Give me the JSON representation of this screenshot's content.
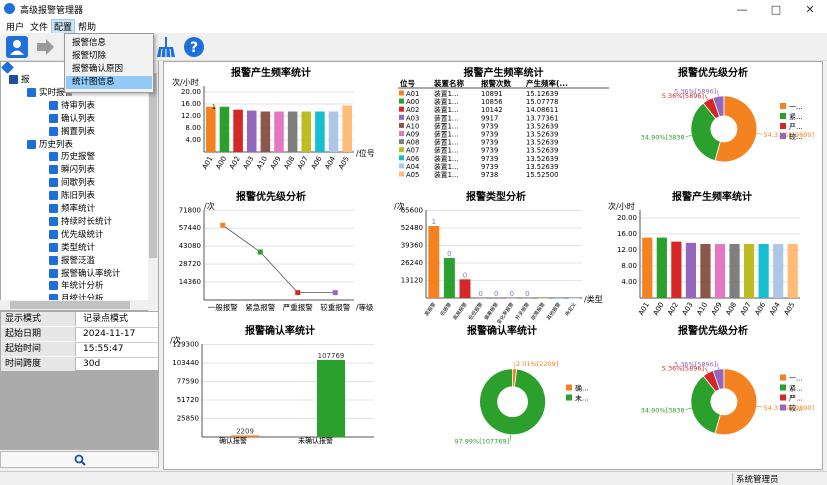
{
  "window": {
    "title": "高级报警管理器",
    "minimize_icon": "minimize-icon",
    "maximize_icon": "maximize-icon",
    "close_icon": "close-icon"
  },
  "menu": [
    {
      "label": "用户"
    },
    {
      "label": "文件"
    },
    {
      "label": "配置"
    },
    {
      "label": "帮助"
    }
  ],
  "dropdown": [
    {
      "label": "报警信息"
    },
    {
      "label": "报警切除"
    },
    {
      "label": "报警确认原因"
    },
    {
      "label": "统计图信息"
    }
  ],
  "toolbar": {
    "icons": [
      "user-icon",
      "export-icon",
      "clean-icon",
      "help-icon"
    ]
  },
  "tree": [
    {
      "label": "报",
      "level": 1
    },
    {
      "label": "实时报警",
      "level": 2
    },
    {
      "label": "待审列表",
      "level": 3
    },
    {
      "label": "确认列表",
      "level": 3
    },
    {
      "label": "搁置列表",
      "level": 3
    },
    {
      "label": "历史列表",
      "level": 2
    },
    {
      "label": "历史报警",
      "level": 3
    },
    {
      "label": "瞬闪列表",
      "level": 3
    },
    {
      "label": "间歇列表",
      "level": 3
    },
    {
      "label": "陈旧列表",
      "level": 3
    },
    {
      "label": "频率统计",
      "level": 3
    },
    {
      "label": "持续时长统计",
      "level": 3
    },
    {
      "label": "优先级统计",
      "level": 3
    },
    {
      "label": "类型统计",
      "level": 3
    },
    {
      "label": "报警泛滥",
      "level": 3
    },
    {
      "label": "报警确认率统计",
      "level": 3
    },
    {
      "label": "年统计分析",
      "level": 3
    },
    {
      "label": "月统计分析",
      "level": 3
    }
  ],
  "info": {
    "mode_key": "显示模式",
    "mode_val": "记录点模式",
    "date_key": "起始日期",
    "date_val": "2024-11-17",
    "time_key": "起始时间",
    "time_val": "15:55:47",
    "span_key": "时间跨度",
    "span_val": "30d"
  },
  "statusbar": {
    "user": "系统管理员"
  },
  "colors": {
    "orange": "#f58220",
    "green": "#2ca02c",
    "red": "#d62728",
    "purple": "#9467bd",
    "brown": "#8c564b",
    "pink": "#e377c2",
    "grey": "#7f7f7f",
    "olive": "#bcbd22",
    "cyan": "#17becf",
    "lightblue": "#aec7e8",
    "lightorange": "#ffbb78"
  },
  "chart_data": [
    {
      "type": "bar",
      "title": "报警产生频率统计",
      "ylabel": "次/小时",
      "xlabel": "/位号",
      "categories": [
        "A01",
        "A00",
        "A02",
        "A03",
        "A10",
        "A09",
        "A08",
        "A07",
        "A06",
        "A04",
        "A05"
      ],
      "values": [
        15.1,
        15.1,
        14.1,
        13.8,
        13.5,
        13.5,
        13.5,
        13.5,
        13.5,
        13.5,
        15.5
      ],
      "ylim": [
        0,
        22
      ],
      "yticks": [
        "4.00",
        "8.00",
        "12.00",
        "16.00",
        "20.00"
      ],
      "data_labels": [
        "1"
      ]
    },
    {
      "type": "table",
      "title": "报警产生频率统计",
      "columns": [
        "位号",
        "装置名称",
        "报警次数",
        "产生频率(..."
      ],
      "rows": [
        [
          "A01",
          "装置1...",
          "10891",
          "15.12639"
        ],
        [
          "A00",
          "装置1...",
          "10856",
          "15.07778"
        ],
        [
          "A02",
          "装置1...",
          "10142",
          "14.08611"
        ],
        [
          "A03",
          "装置1...",
          "9917",
          "13.77361"
        ],
        [
          "A10",
          "装置1...",
          "9739",
          "13.52639"
        ],
        [
          "A09",
          "装置1...",
          "9739",
          "13.52639"
        ],
        [
          "A08",
          "装置1...",
          "9739",
          "13.52639"
        ],
        [
          "A07",
          "装置1...",
          "9739",
          "13.52639"
        ],
        [
          "A06",
          "装置1...",
          "9739",
          "13.52639"
        ],
        [
          "A04",
          "装置1...",
          "9739",
          "13.52639"
        ],
        [
          "A05",
          "装置1...",
          "9738",
          "15.52500"
        ]
      ]
    },
    {
      "type": "pie",
      "title": "报警优先级分析",
      "slices": [
        {
          "name": "一...",
          "value": 54.37,
          "label": "54.37%[59800]"
        },
        {
          "name": "紧...",
          "value": 34.9,
          "label": "34.90%[3838"
        },
        {
          "name": "严...",
          "value": 5.36,
          "label": "5.36%[5896]"
        },
        {
          "name": "较...",
          "value": 5.36,
          "label": "5.36%[5896]"
        }
      ]
    },
    {
      "type": "line",
      "title": "报警优先级分析",
      "ylabel": "/次",
      "xlabel": "/等级",
      "categories": [
        "一般报警",
        "紧急报警",
        "严重报警",
        "较重报警"
      ],
      "values": [
        59800,
        38380,
        5896,
        5896
      ],
      "ylim": [
        0,
        72000
      ],
      "yticks": [
        "14360",
        "28720",
        "43080",
        "57440",
        "71800"
      ]
    },
    {
      "type": "bar",
      "title": "报警类型分析",
      "ylabel": "/次",
      "xlabel": "/类型",
      "categories": [
        "高报警",
        "低报警",
        "高高报警",
        "低低报警",
        "偏差报警",
        "变化率报警",
        "开关报警",
        "故障报警",
        "其他报警",
        "未定义"
      ],
      "values": [
        54000,
        30000,
        14000,
        0,
        0,
        0,
        0,
        0,
        0,
        0
      ],
      "data_labels": [
        "1",
        "0",
        "0",
        "0",
        "0",
        "0",
        "0"
      ],
      "ylim": [
        0,
        66000
      ],
      "yticks": [
        "13120",
        "26240",
        "39360",
        "52480",
        "65600"
      ]
    },
    {
      "type": "bar",
      "title": "报警产生频率统计",
      "ylabel": "次/小时",
      "categories": [
        "A01",
        "A00",
        "A02",
        "A03",
        "A10",
        "A09",
        "A08",
        "A07",
        "A06",
        "A04",
        "A05"
      ],
      "values": [
        15.1,
        15.1,
        14.1,
        13.8,
        13.5,
        13.5,
        13.5,
        13.5,
        13.5,
        13.5,
        13.5
      ],
      "ylim": [
        0,
        22
      ],
      "yticks": [
        "4.00",
        "8.00",
        "12.00",
        "16.00",
        "20.00"
      ]
    },
    {
      "type": "bar",
      "title": "报警确认率统计",
      "ylabel": "/次",
      "categories": [
        "确认报警",
        "未确认报警"
      ],
      "values": [
        2209,
        107769
      ],
      "data_labels": [
        "2209",
        "107769"
      ],
      "ylim": [
        0,
        130000
      ],
      "yticks": [
        "25850",
        "51720",
        "77590",
        "103440",
        "129300"
      ]
    },
    {
      "type": "pie",
      "title": "报警确认率统计",
      "slices": [
        {
          "name": "确...",
          "value": 2.01,
          "label": "2.01%[2209]"
        },
        {
          "name": "未...",
          "value": 97.99,
          "label": "97.99%[107769]"
        }
      ]
    },
    {
      "type": "pie",
      "title": "报警优先级分析",
      "slices": [
        {
          "name": "一...",
          "value": 54.37,
          "label": "54.37%[59800]"
        },
        {
          "name": "紧...",
          "value": 34.9,
          "label": "34.90%[3838"
        },
        {
          "name": "严...",
          "value": 5.36,
          "label": "5.36%[5896]"
        },
        {
          "name": "较...",
          "value": 5.36,
          "label": "5.36%[5896]"
        }
      ]
    }
  ]
}
